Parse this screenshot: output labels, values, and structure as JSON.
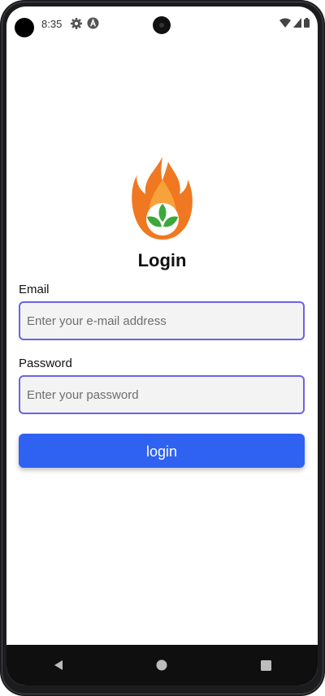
{
  "status_bar": {
    "time": "8:35",
    "icons": [
      "gear-icon",
      "a-icon",
      "wifi-icon",
      "signal-icon",
      "battery-icon"
    ]
  },
  "login": {
    "title": "Login",
    "email_label": "Email",
    "email_placeholder": "Enter your e-mail address",
    "password_label": "Password",
    "password_placeholder": "Enter your password",
    "button_label": "login"
  },
  "nav": {
    "icons": [
      "back-icon",
      "home-icon",
      "recents-icon"
    ]
  },
  "colors": {
    "accent": "#2f62f0",
    "field_border": "#6b63e6",
    "flame_orange": "#f07820",
    "leaf_green": "#3ca83c"
  }
}
